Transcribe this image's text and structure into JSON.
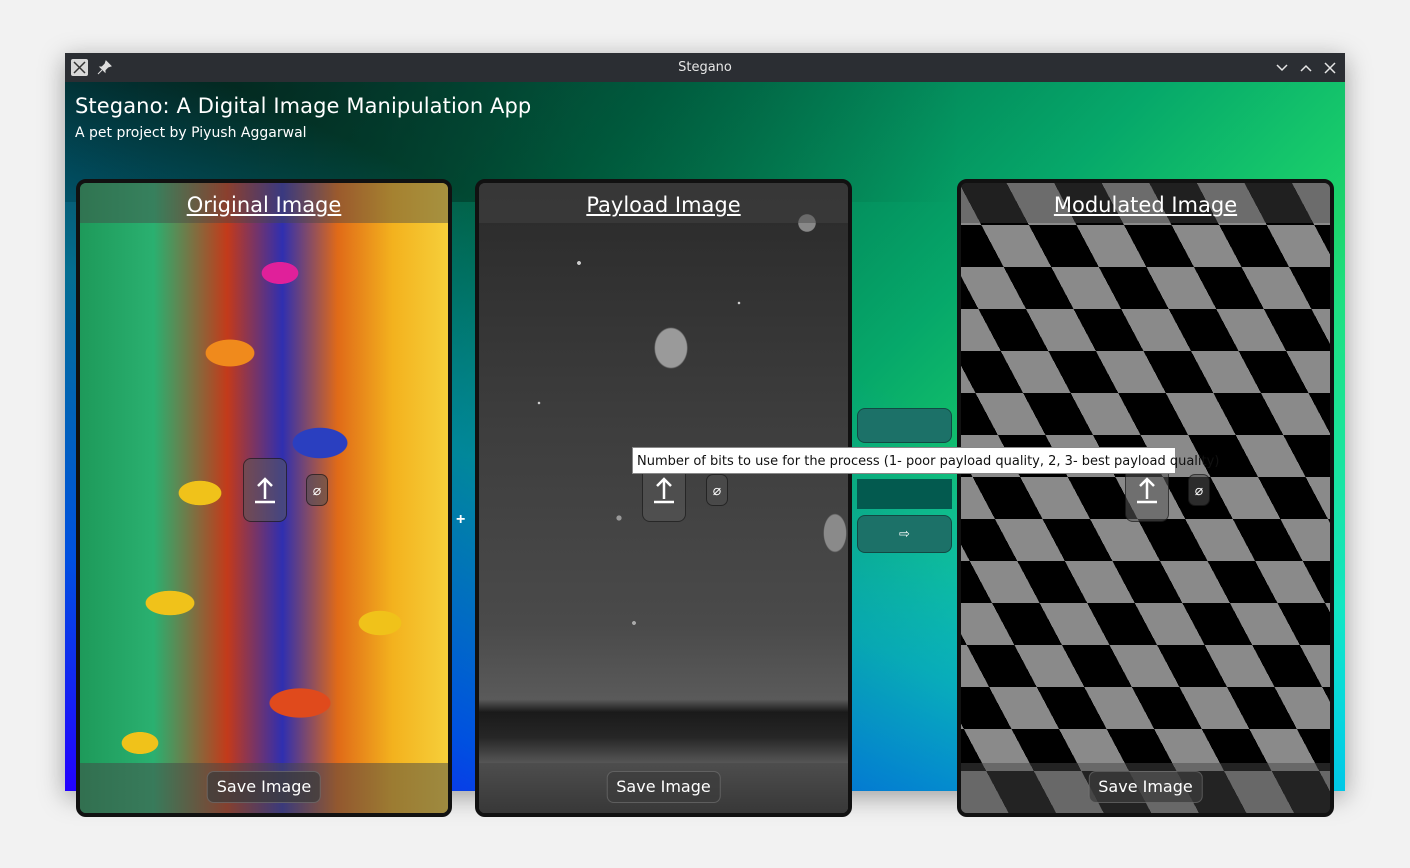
{
  "window": {
    "title": "Stegano",
    "controls": [
      "minimize",
      "maximize",
      "close"
    ]
  },
  "header": {
    "title": "Stegano: A Digital Image Manipulation App",
    "subtitle": "A pet project by Piyush Aggarwal"
  },
  "panels": {
    "original": {
      "title": "Original Image",
      "save_label": "Save Image",
      "upload_icon": "upload-icon",
      "clear_icon": "⌀"
    },
    "payload": {
      "title": "Payload Image",
      "save_label": "Save Image",
      "upload_icon": "upload-icon",
      "clear_icon": "⌀"
    },
    "modulated": {
      "title": "Modulated Image",
      "save_label": "Save Image",
      "upload_icon": "upload-icon",
      "clear_icon": "⌀"
    }
  },
  "operator": {
    "plus": "+"
  },
  "controls": {
    "bits_value": "",
    "apply_label": "⇨"
  },
  "tooltip": {
    "text": "Number of bits to use for the process (1- poor payload quality, 2, 3- best payload quality)"
  },
  "colors": {
    "accent_button": "#1c7168",
    "bits_field": "#035a4f",
    "titlebar": "#2b2e33"
  }
}
